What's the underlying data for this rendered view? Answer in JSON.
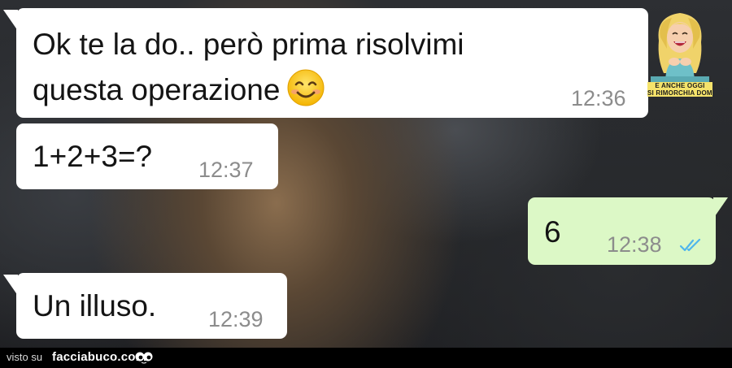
{
  "messages": [
    {
      "direction": "incoming",
      "lines": [
        "Ok te la do.. però prima risolvimi",
        "questa operazione"
      ],
      "emoji": "smiling-face-icon",
      "time": "12:36"
    },
    {
      "direction": "incoming",
      "lines": [
        "1+2+3=?"
      ],
      "time": "12:37"
    },
    {
      "direction": "outgoing",
      "lines": [
        "6"
      ],
      "time": "12:38",
      "status": "read-double-tick-icon"
    },
    {
      "direction": "incoming",
      "lines": [
        "Un illuso."
      ],
      "time": "12:39"
    }
  ],
  "sticker": {
    "caption_line1": "E ANCHE OGGI",
    "caption_line2": "SI RIMORCHIA DOMANI"
  },
  "footer": {
    "visto_su": "visto su",
    "site": "facciabuco.com"
  },
  "colors": {
    "incoming_bubble": "#ffffff",
    "outgoing_bubble": "#dcf8c6",
    "read_tick": "#4fb6ec",
    "time_text": "#8c8c8c"
  }
}
